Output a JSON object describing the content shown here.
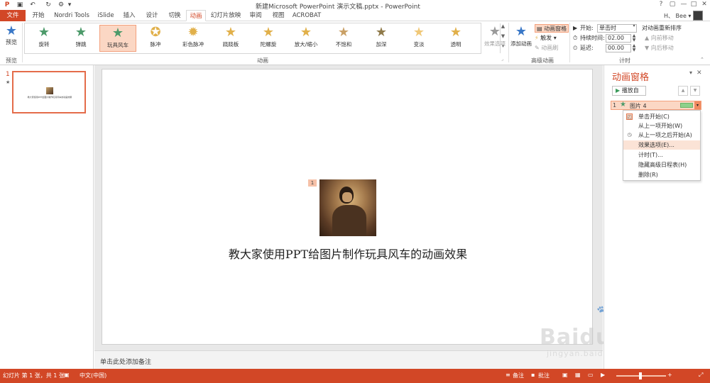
{
  "window": {
    "title": "新建Microsoft PowerPoint 演示文稿.pptx - PowerPoint",
    "help": "?",
    "restore": "▢",
    "minimize": "—",
    "maximize": "□",
    "close": "✕"
  },
  "quick_access": {
    "save_icon": "save-icon",
    "undo_icon": "undo-icon",
    "redo_icon": "redo-icon",
    "customize_icon": "customize-icon"
  },
  "tabs": [
    {
      "label": "文件"
    },
    {
      "label": "开始"
    },
    {
      "label": "Nordri Tools"
    },
    {
      "label": "iSlide"
    },
    {
      "label": "插入"
    },
    {
      "label": "设计"
    },
    {
      "label": "切换"
    },
    {
      "label": "动画"
    },
    {
      "label": "幻灯片放映"
    },
    {
      "label": "审阅"
    },
    {
      "label": "视图"
    },
    {
      "label": "ACROBAT"
    }
  ],
  "user": {
    "name": "H、 Bee ▾"
  },
  "ribbon": {
    "preview": {
      "label": "预览",
      "group": "预览"
    },
    "animation_group": "动画",
    "animations": [
      {
        "label": "旋转",
        "color": "green"
      },
      {
        "label": "弹跳",
        "color": "green"
      },
      {
        "label": "玩具风车",
        "color": "green",
        "selected": true
      },
      {
        "label": "脉冲",
        "color": "gold"
      },
      {
        "label": "彩色脉冲",
        "color": "gold"
      },
      {
        "label": "跷跷板",
        "color": "gold"
      },
      {
        "label": "陀螺旋",
        "color": "gold"
      },
      {
        "label": "放大/缩小",
        "color": "gold"
      },
      {
        "label": "不饱和",
        "color": "gold"
      },
      {
        "label": "加深",
        "color": "gold"
      },
      {
        "label": "变淡",
        "color": "gold"
      },
      {
        "label": "透明",
        "color": "gold"
      }
    ],
    "effect_options": "效果选项",
    "advanced": {
      "group": "高级动画",
      "add_animation": "添加动画",
      "animation_pane": "动画窗格",
      "trigger": "触发 ▾",
      "animation_painter": "动画刷"
    },
    "timing": {
      "group": "计时",
      "start_label": "开始:",
      "start_value": "单击时",
      "duration_label": "持续时间:",
      "duration_value": "02.00",
      "delay_label": "延迟:",
      "delay_value": "00.00",
      "reorder_title": "对动画重新排序",
      "move_earlier": "向前移动",
      "move_later": "向后移动"
    }
  },
  "thumbnails": {
    "slide_number": "1",
    "star": "★",
    "caption": "教大家使用PPT给图片制作玩具风车的动画效果"
  },
  "slide": {
    "badge": "1",
    "caption": "教大家使用PPT给图片制作玩具风车的动画效果",
    "notes_placeholder": "单击此处添加备注"
  },
  "animation_pane": {
    "title": "动画窗格",
    "play_button": "播放自",
    "item": {
      "number": "1",
      "label": "图片 4"
    }
  },
  "context_menu": [
    {
      "label": "单击开始(C)",
      "icon": "mouse-click-icon"
    },
    {
      "label": "从上一项开始(W)",
      "icon": ""
    },
    {
      "label": "从上一项之后开始(A)",
      "icon": "clock-icon"
    },
    {
      "label": "效果选项(E)...",
      "icon": "",
      "hover": true
    },
    {
      "label": "计时(T)...",
      "icon": ""
    },
    {
      "label": "隐藏高级日程表(H)",
      "icon": ""
    },
    {
      "label": "删除(R)",
      "icon": ""
    }
  ],
  "statusbar": {
    "slide_info": "幻灯片 第 1 张，共 1 张",
    "language": "中文(中国)",
    "notes": "备注",
    "comments": "批注"
  },
  "page_nav": "0",
  "watermark": {
    "brand": "Baidu经验",
    "url": "jingyan.baidu.com"
  },
  "colors": {
    "accent": "#d24726",
    "selected_fill": "#fbd7c4",
    "status_green": "#8fd18b"
  }
}
